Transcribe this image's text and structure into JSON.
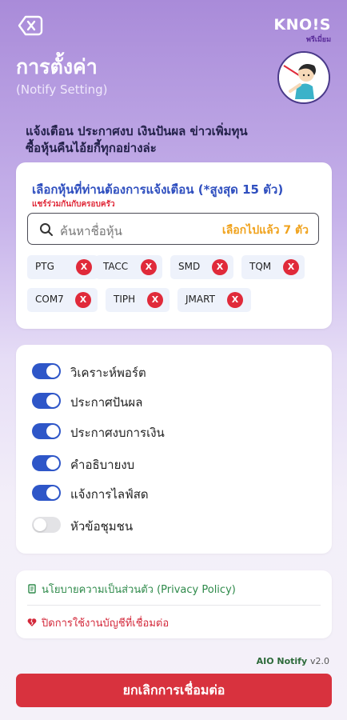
{
  "header": {
    "brand_logo": "KNO!S",
    "brand_sub": "พรีเมี่ยม",
    "title": "การตั้งค่า",
    "subtitle": "(Notify Setting)"
  },
  "intro": {
    "line1": "แจ้งเตือน ประกาศงบ เงินปันผล ข่าวเพิ่มทุน",
    "line2": "ซื้อหุ้นคืนไอ้ยกี้ทุกอย่างล่ะ"
  },
  "stock_picker": {
    "title": "เลือกหุ้นที่ท่านต้องการแจ้งเตือน (*สูงสุด 15 ตัว)",
    "warning": "แชร์ร่วมกันกับครอบครัว",
    "search_placeholder": "ค้นหาชื่อหุ้น",
    "selected_count": "เลือกไปแล้ว 7 ตัว",
    "chips": [
      "PTG",
      "TACC",
      "SMD",
      "TQM",
      "COM7",
      "TIPH",
      "JMART"
    ],
    "remove_glyph": "X"
  },
  "toggles": [
    {
      "label": "วิเคราะห์พอร์ต",
      "on": true
    },
    {
      "label": "ประกาศปันผล",
      "on": true
    },
    {
      "label": "ประกาศงบการเงิน",
      "on": true
    },
    {
      "label": "คำอธิบายงบ",
      "on": true
    },
    {
      "label": "แจ้งการไลฟ์สด",
      "on": true
    },
    {
      "label": "หัวข้อชุมชน",
      "on": false
    }
  ],
  "links": {
    "privacy": "นโยบายความเป็นส่วนตัว (Privacy Policy)",
    "disconnect_account": "ปิดการใช้งานบัญชีที่เชื่อมต่อ"
  },
  "version": {
    "name": "AIO Notify",
    "number": "v2.0"
  },
  "cta": {
    "label": "ยกเลิกการเชื่อมต่อ"
  },
  "colors": {
    "accent_blue": "#2e56c8",
    "danger_red": "#d8323e",
    "count_orange": "#f0a21c",
    "privacy_green": "#2e8a4a"
  }
}
